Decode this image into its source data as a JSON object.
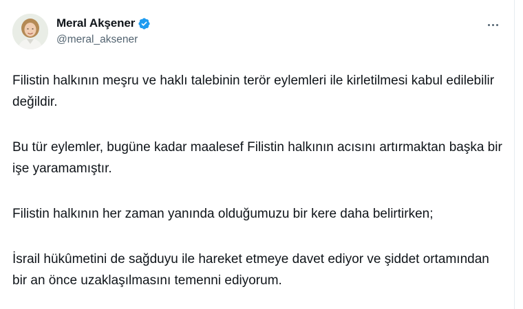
{
  "author": {
    "display_name": "Meral Akşener",
    "handle": "@meral_aksener",
    "verified": true,
    "verified_color": "#1d9bf0"
  },
  "icons": {
    "more": "more-horizontal-icon",
    "verified": "verified-badge-icon",
    "avatar": "profile-photo"
  },
  "tweet": {
    "paragraphs": [
      "Filistin halkının meşru ve haklı talebinin terör eylemleri ile kirletilmesi kabul edilebilir değildir.",
      "Bu tür eylemler, bugüne kadar maalesef Filistin halkının acısını artırmaktan başka bir işe yaramamıştır.",
      "Filistin halkının her zaman yanında olduğumuzu bir kere daha belirtirken;",
      "İsrail hükûmetini de sağduyu ile hareket etmeye davet ediyor ve şiddet ortamından bir an önce uzaklaşılmasını temenni ediyorum."
    ]
  },
  "colors": {
    "text_primary": "#0f1419",
    "text_secondary": "#536471",
    "background": "#ffffff"
  }
}
